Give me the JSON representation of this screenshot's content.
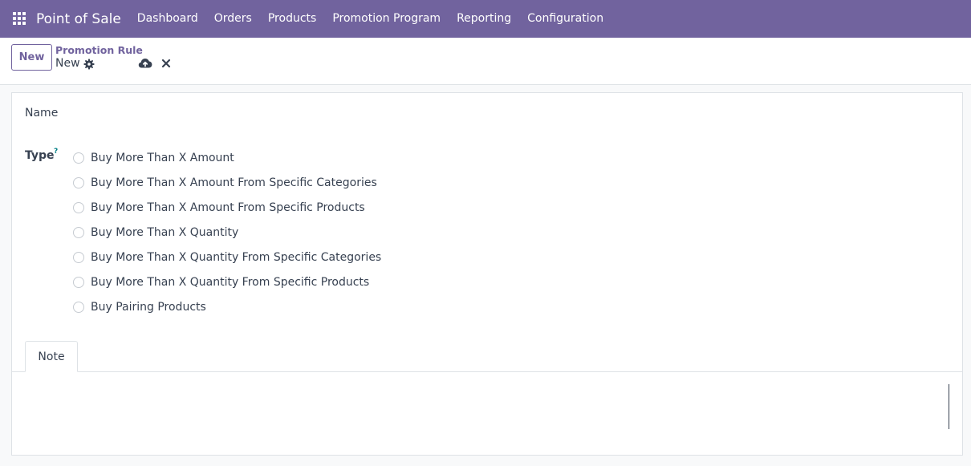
{
  "navbar": {
    "app_name": "Point of Sale",
    "menu": [
      "Dashboard",
      "Orders",
      "Products",
      "Promotion Program",
      "Reporting",
      "Configuration"
    ],
    "color": "#71639e"
  },
  "control": {
    "new_label": "New",
    "breadcrumb": "Promotion Rule",
    "record_name": "New"
  },
  "form": {
    "name_label": "Name",
    "name_value": "",
    "type_label": "Type",
    "type_help": "?",
    "type_options": [
      "Buy More Than X Amount",
      "Buy More Than X Amount From Specific Categories",
      "Buy More Than X Amount From Specific Products",
      "Buy More Than X Quantity",
      "Buy More Than X Quantity From Specific Categories",
      "Buy More Than X Quantity From Specific Products",
      "Buy Pairing Products"
    ],
    "tabs": [
      "Note"
    ],
    "note_value": ""
  }
}
